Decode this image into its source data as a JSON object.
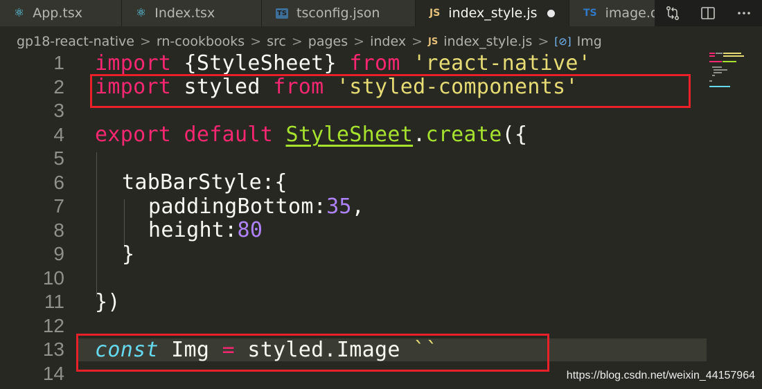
{
  "tabs": [
    {
      "label": "App.tsx",
      "icon": "react-icon",
      "active": false
    },
    {
      "label": "Index.tsx",
      "icon": "react-icon",
      "active": false
    },
    {
      "label": "tsconfig.json",
      "icon": "ts-icon",
      "active": false
    },
    {
      "label": "index_style.js",
      "icon": "js-icon",
      "active": true,
      "modified": true
    },
    {
      "label": "image.d",
      "icon": "ts-icon",
      "active": false
    }
  ],
  "tab_icons": {
    "js": "JS",
    "ts": "TS",
    "tsbox": "TS",
    "react": "⚛"
  },
  "breadcrumb": {
    "items": [
      "gp18-react-native",
      "rn-cookbooks",
      "src",
      "pages",
      "index",
      "index_style.js",
      "Img"
    ],
    "separator": ">"
  },
  "editor": {
    "lines": [
      {
        "number": "1"
      },
      {
        "number": "2"
      },
      {
        "number": "3"
      },
      {
        "number": "4"
      },
      {
        "number": "5"
      },
      {
        "number": "6"
      },
      {
        "number": "7"
      },
      {
        "number": "8"
      },
      {
        "number": "9"
      },
      {
        "number": "10"
      },
      {
        "number": "11"
      },
      {
        "number": "12"
      },
      {
        "number": "13"
      },
      {
        "number": "14"
      }
    ],
    "code": {
      "l1": {
        "kw1": "import",
        "t1": " {StyleSheet} ",
        "kw2": "from",
        "t2": " ",
        "str": "'react-native'"
      },
      "l2": {
        "kw1": "import",
        "t1": " styled ",
        "kw2": "from",
        "t2": " ",
        "str": "'styled-components'"
      },
      "l4": {
        "kw1": "export",
        "t1": " ",
        "kw2": "default",
        "t2": " ",
        "cls": "StyleSheet",
        "t3": ".",
        "fn": "create",
        "t4": "({"
      },
      "l6": {
        "t": "tabBarStyle:{"
      },
      "l7": {
        "t": "paddingBottom:",
        "num": "35",
        "t2": ","
      },
      "l8": {
        "t": "height:",
        "num": "80"
      },
      "l9": {
        "t": "}"
      },
      "l11": {
        "t": "})"
      },
      "l13": {
        "kw": "const",
        "t1": " Img ",
        "op": "=",
        "t2": " styled.Image ",
        "str": "``"
      }
    }
  },
  "colors": {
    "background": "#272822",
    "keyword": "#f92672",
    "string": "#e6db74",
    "class": "#a6e22e",
    "number": "#ae81ff",
    "storage": "#66d9ef",
    "highlight_box": "#e8202a"
  },
  "watermark": "https://blog.csdn.net/weixin_44157964"
}
